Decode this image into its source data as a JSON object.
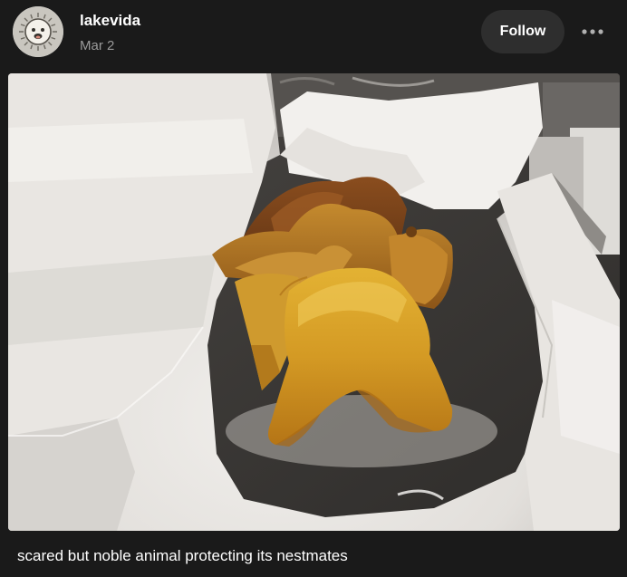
{
  "post": {
    "username": "lakevida",
    "date": "Mar 2",
    "follow_label": "Follow",
    "more_icon": "ellipsis-horizontal-icon",
    "avatar_icon": "sun-face-icon",
    "caption": "scared but noble animal protecting its nestmates"
  },
  "colors": {
    "background": "#1a1a1a",
    "follow_button_bg": "#2e2e2e",
    "date_text": "#9a9a9a",
    "text": "#ffffff"
  }
}
